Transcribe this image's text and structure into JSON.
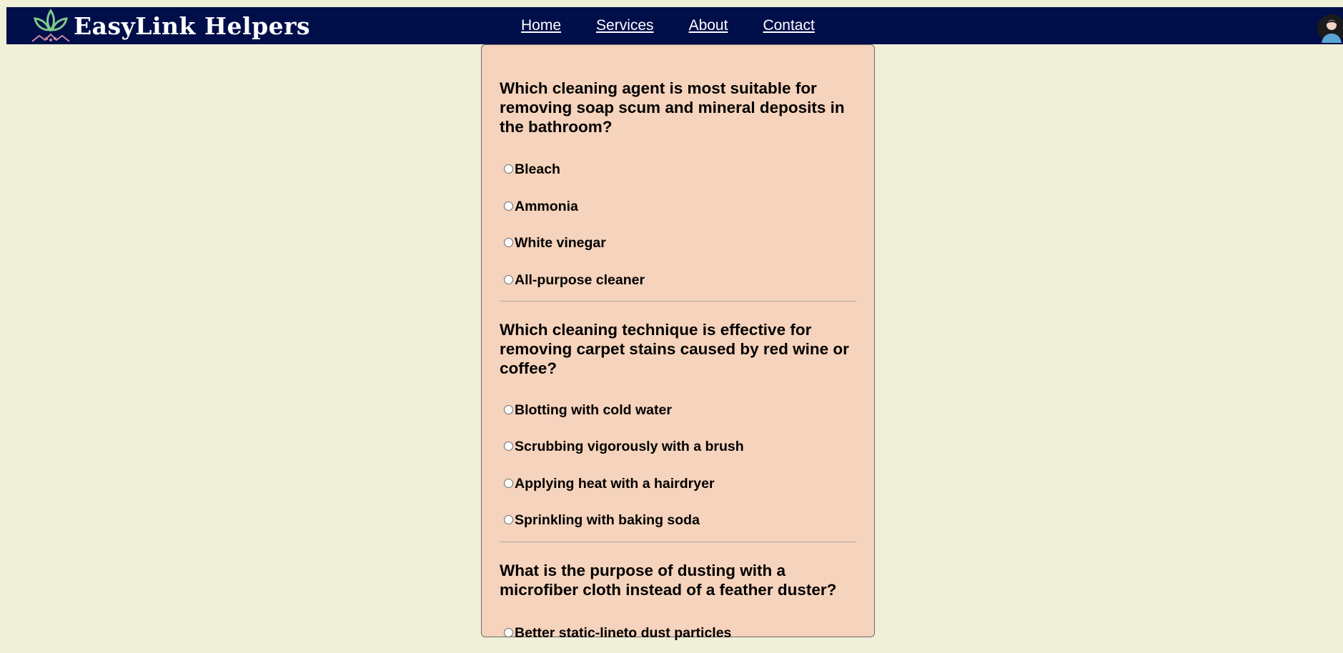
{
  "brand": {
    "name": "EasyLink Helpers",
    "logo_icon": "lotus-leaf-icon"
  },
  "nav": {
    "items": [
      {
        "label": "Home"
      },
      {
        "label": "Services"
      },
      {
        "label": "About"
      },
      {
        "label": "Contact"
      }
    ],
    "avatar_icon": "user-avatar-icon"
  },
  "colors": {
    "background": "#f0efd8",
    "navbar": "#000e4a",
    "card": "#f6d3bc"
  },
  "quiz": {
    "questions": [
      {
        "text": "Which cleaning agent is most suitable for removing soap scum and mineral deposits in the bathroom?",
        "options": [
          "Bleach",
          "Ammonia",
          "White vinegar",
          "All-purpose cleaner"
        ]
      },
      {
        "text": "Which cleaning technique is effective for removing carpet stains caused by red wine or coffee?",
        "options": [
          "Blotting with cold water",
          "Scrubbing vigorously with a brush",
          "Applying heat with a hairdryer",
          "Sprinkling with baking soda"
        ]
      },
      {
        "text": "What is the purpose of dusting with a microfiber cloth instead of a feather duster?",
        "options": [
          "Better static-lineto dust particles"
        ]
      }
    ]
  }
}
